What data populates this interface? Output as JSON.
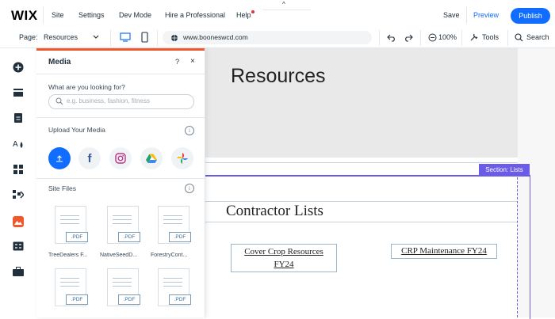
{
  "topbar": {
    "logo": "WIX",
    "menu": [
      "Site",
      "Settings",
      "Dev Mode",
      "Hire a Professional",
      "Help"
    ],
    "save_label": "Save",
    "preview_label": "Preview",
    "publish_label": "Publish"
  },
  "subbar": {
    "page_label": "Page:",
    "page_value": "Resources",
    "url": "www.booneswcd.com",
    "zoom": "100%",
    "tools_label": "Tools",
    "search_label": "Search"
  },
  "left_toolbar": {
    "icons": [
      "add-icon",
      "sections-icon",
      "pages-icon",
      "design-icon",
      "apps-icon",
      "app-market-icon",
      "media-icon",
      "business-icon",
      "portfolio-icon"
    ],
    "active": "media-icon"
  },
  "media_panel": {
    "title": "Media",
    "help": "?",
    "close": "×",
    "search_question": "What are you looking for?",
    "search_placeholder": "e.g. business, fashion, fitness",
    "upload_heading": "Upload Your Media",
    "sources": [
      "upload-icon",
      "facebook-icon",
      "instagram-icon",
      "google-drive-icon",
      "google-photos-icon"
    ],
    "site_files_heading": "Site Files",
    "files": [
      {
        "type": ".PDF",
        "name": "TreeDealers F..."
      },
      {
        "type": ".PDF",
        "name": "NativeSeedD..."
      },
      {
        "type": ".PDF",
        "name": "ForestryCont..."
      },
      {
        "type": ".PDF",
        "name": ""
      },
      {
        "type": ".PDF",
        "name": ""
      },
      {
        "type": ".PDF",
        "name": ""
      }
    ]
  },
  "canvas": {
    "hero_title": "Resources",
    "section_tag": "Section: Lists",
    "list_title": "Contractor Lists",
    "buttons": [
      {
        "line1": "Cover Crop Resources",
        "line2": "FY24"
      },
      {
        "line1": "CRP Maintenance FY24",
        "line2": ""
      }
    ]
  },
  "colors": {
    "accent_blue": "#116dff",
    "panel_accent": "#f0582e",
    "section_purple": "#6b5ce7"
  }
}
